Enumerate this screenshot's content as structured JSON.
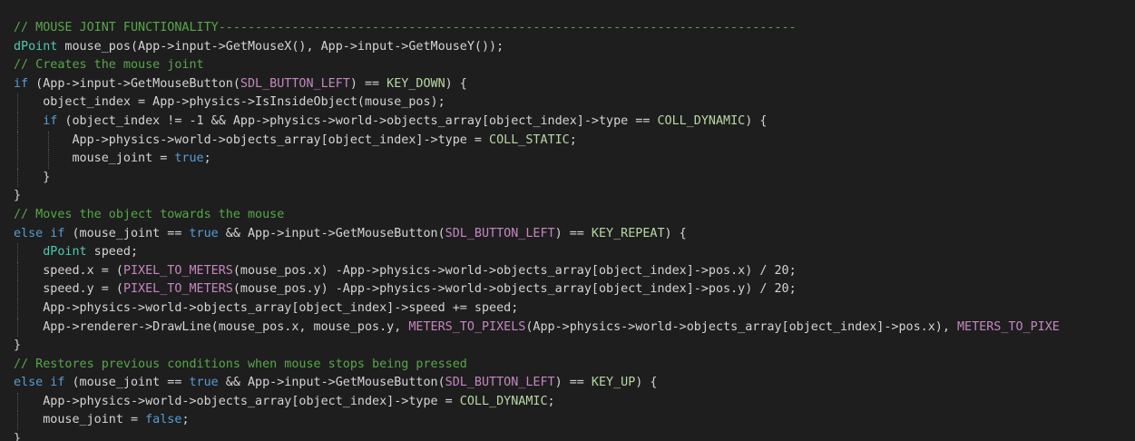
{
  "editor": {
    "background": "#1e1e1e",
    "colors": {
      "c": "#57a64a",
      "k": "#569cd6",
      "ty": "#4ec9b0",
      "f": "#dcdcaa",
      "m": "#c586c0",
      "e": "#b8d7a3",
      "n": "#b5cea8",
      "p": "#d4d4d4",
      "v": "#9cdcfe"
    },
    "lines": [
      {
        "indent": 0,
        "tokens": [
          [
            "c",
            "// MOUSE JOINT FUNCTIONALITY-------------------------------------------------------------------------------"
          ]
        ]
      },
      {
        "indent": 0,
        "tokens": [
          [
            "ty",
            "dPoint"
          ],
          [
            "p",
            " mouse_pos(App->input->GetMouseX(), App->input->GetMouseY());"
          ]
        ]
      },
      {
        "indent": 0,
        "tokens": [
          [
            "c",
            "// Creates the mouse joint"
          ]
        ]
      },
      {
        "indent": 0,
        "tokens": [
          [
            "k",
            "if"
          ],
          [
            "p",
            " (App->input->GetMouseButton("
          ],
          [
            "m",
            "SDL_BUTTON_LEFT"
          ],
          [
            "p",
            ") == "
          ],
          [
            "e",
            "KEY_DOWN"
          ],
          [
            "p",
            ") {"
          ]
        ]
      },
      {
        "indent": 1,
        "tokens": [
          [
            "p",
            "    object_index = App->physics->IsInsideObject(mouse_pos);"
          ]
        ]
      },
      {
        "indent": 1,
        "tokens": [
          [
            "p",
            "    "
          ],
          [
            "k",
            "if"
          ],
          [
            "p",
            " (object_index != -1 && App->physics->world->objects_array[object_index]->type == "
          ],
          [
            "e",
            "COLL_DYNAMIC"
          ],
          [
            "p",
            ") {"
          ]
        ]
      },
      {
        "indent": 2,
        "tokens": [
          [
            "p",
            "        App->physics->world->objects_array[object_index]->type = "
          ],
          [
            "e",
            "COLL_STATIC"
          ],
          [
            "p",
            ";"
          ]
        ]
      },
      {
        "indent": 2,
        "tokens": [
          [
            "p",
            "        mouse_joint = "
          ],
          [
            "k",
            "true"
          ],
          [
            "p",
            ";"
          ]
        ]
      },
      {
        "indent": 1,
        "tokens": [
          [
            "p",
            "    }"
          ]
        ]
      },
      {
        "indent": 0,
        "tokens": [
          [
            "p",
            "}"
          ]
        ]
      },
      {
        "indent": 0,
        "tokens": [
          [
            "c",
            "// Moves the object towards the mouse"
          ]
        ]
      },
      {
        "indent": 0,
        "tokens": [
          [
            "k",
            "else if"
          ],
          [
            "p",
            " (mouse_joint == "
          ],
          [
            "k",
            "true"
          ],
          [
            "p",
            " && App->input->GetMouseButton("
          ],
          [
            "m",
            "SDL_BUTTON_LEFT"
          ],
          [
            "p",
            ") == "
          ],
          [
            "e",
            "KEY_REPEAT"
          ],
          [
            "p",
            ") {"
          ]
        ]
      },
      {
        "indent": 1,
        "tokens": [
          [
            "p",
            "    "
          ],
          [
            "ty",
            "dPoint"
          ],
          [
            "p",
            " speed;"
          ]
        ]
      },
      {
        "indent": 1,
        "tokens": [
          [
            "p",
            "    speed.x = ("
          ],
          [
            "m",
            "PIXEL_TO_METERS"
          ],
          [
            "p",
            "(mouse_pos.x) -App->physics->world->objects_array[object_index]->pos.x) / 20;"
          ]
        ]
      },
      {
        "indent": 1,
        "tokens": [
          [
            "p",
            "    speed.y = ("
          ],
          [
            "m",
            "PIXEL_TO_METERS"
          ],
          [
            "p",
            "(mouse_pos.y) -App->physics->world->objects_array[object_index]->pos.y) / 20;"
          ]
        ]
      },
      {
        "indent": 1,
        "tokens": [
          [
            "p",
            "    App->physics->world->objects_array[object_index]->speed += speed;"
          ]
        ]
      },
      {
        "indent": 1,
        "tokens": [
          [
            "p",
            "    App->renderer->DrawLine(mouse_pos.x, mouse_pos.y, "
          ],
          [
            "m",
            "METERS_TO_PIXELS"
          ],
          [
            "p",
            "(App->physics->world->objects_array[object_index]->pos.x), "
          ],
          [
            "m",
            "METERS_TO_PIXE"
          ]
        ]
      },
      {
        "indent": 0,
        "tokens": [
          [
            "p",
            "}"
          ]
        ]
      },
      {
        "indent": 0,
        "tokens": [
          [
            "c",
            "// Restores previous conditions when mouse stops being pressed"
          ]
        ]
      },
      {
        "indent": 0,
        "tokens": [
          [
            "k",
            "else if"
          ],
          [
            "p",
            " (mouse_joint == "
          ],
          [
            "k",
            "true"
          ],
          [
            "p",
            " && App->input->GetMouseButton("
          ],
          [
            "m",
            "SDL_BUTTON_LEFT"
          ],
          [
            "p",
            ") == "
          ],
          [
            "e",
            "KEY_UP"
          ],
          [
            "p",
            ") {"
          ]
        ]
      },
      {
        "indent": 1,
        "tokens": [
          [
            "p",
            "    App->physics->world->objects_array[object_index]->type = "
          ],
          [
            "e",
            "COLL_DYNAMIC"
          ],
          [
            "p",
            ";"
          ]
        ]
      },
      {
        "indent": 1,
        "tokens": [
          [
            "p",
            "    mouse_joint = "
          ],
          [
            "k",
            "false"
          ],
          [
            "p",
            ";"
          ]
        ]
      },
      {
        "indent": 0,
        "tokens": [
          [
            "p",
            "}"
          ]
        ]
      }
    ]
  }
}
